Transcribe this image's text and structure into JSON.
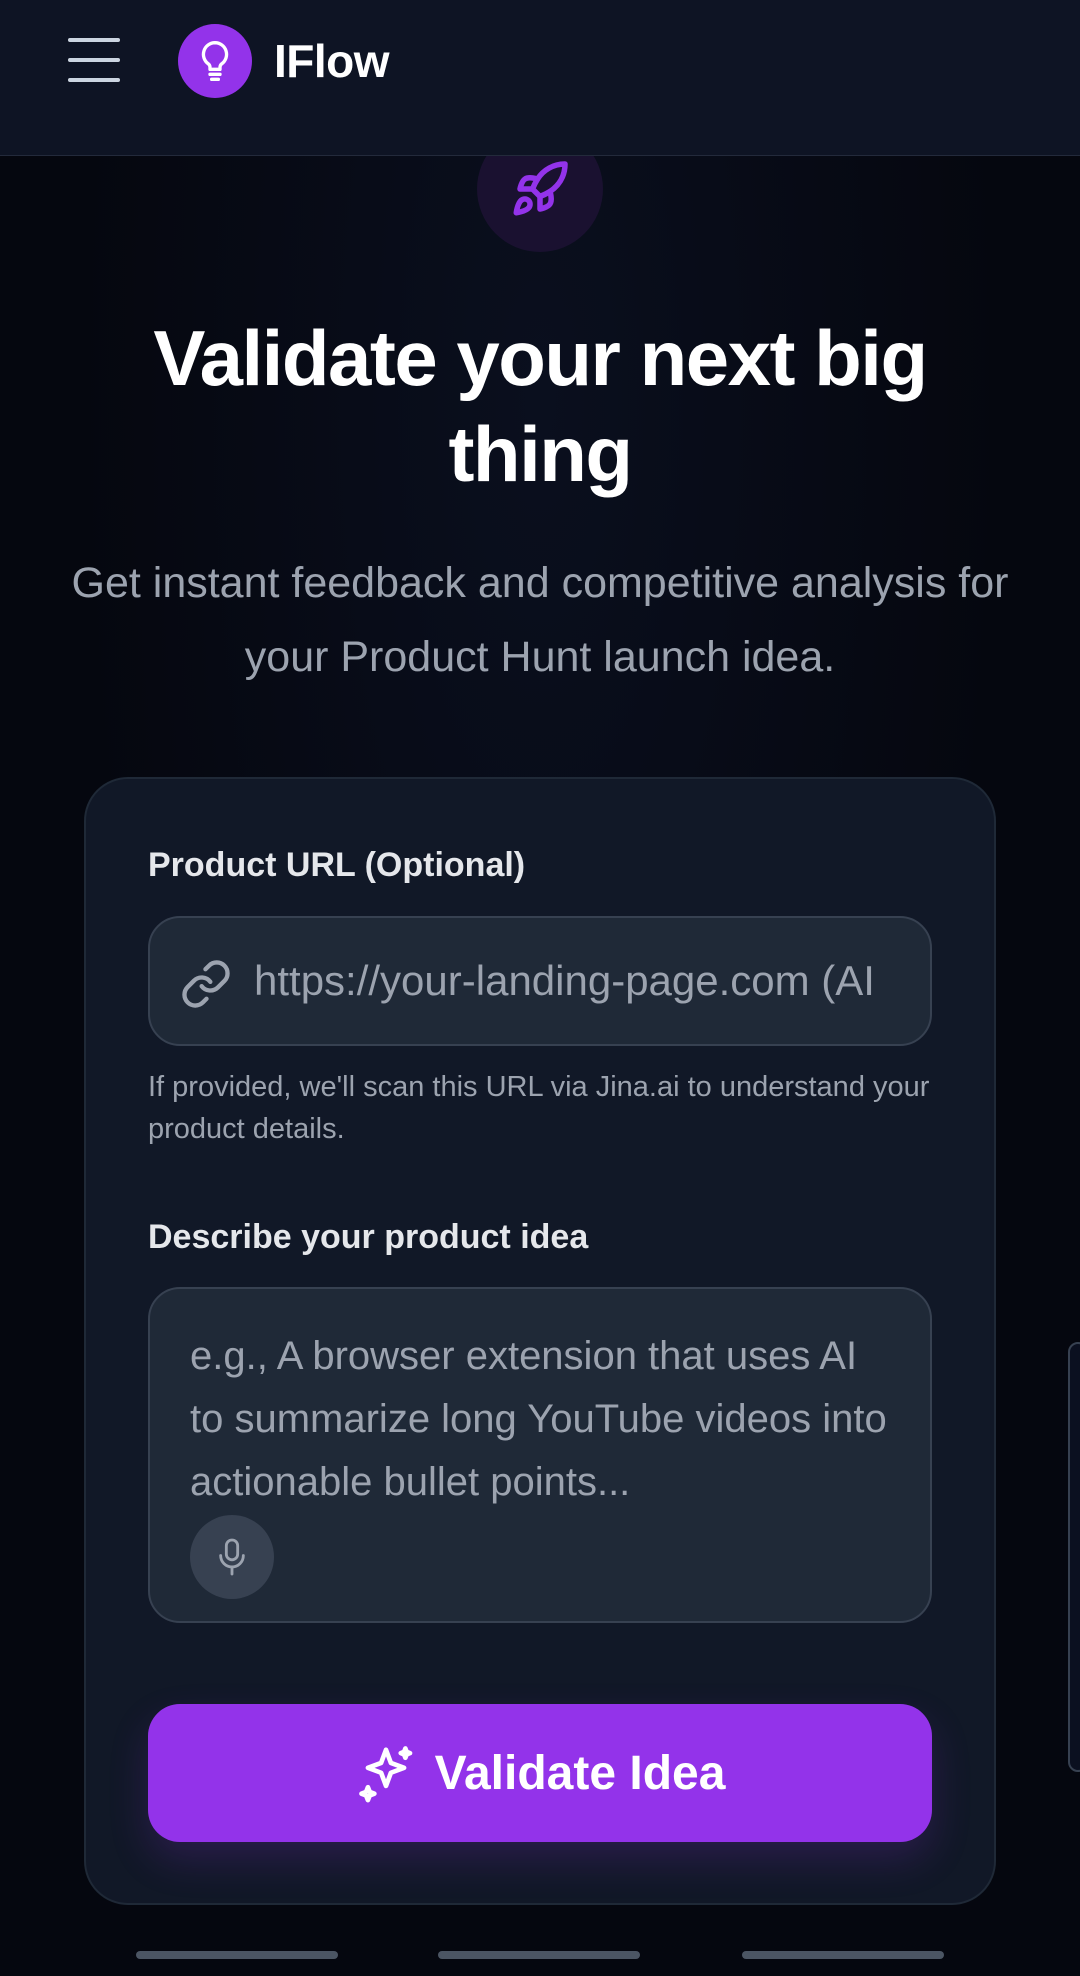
{
  "header": {
    "brand": "IFlow",
    "menu_icon": "hamburger-menu-icon",
    "logo_icon": "lightbulb-icon"
  },
  "hero": {
    "icon": "rocket-icon",
    "title": "Validate your next big thing",
    "subtitle": "Get instant feedback and competitive analysis for your Product Hunt launch idea."
  },
  "form": {
    "url_label": "Product URL (Optional)",
    "url_placeholder": "https://your-landing-page.com (AI",
    "url_value": "",
    "url_icon": "link-icon",
    "url_helper": "If provided, we'll scan this URL via Jina.ai to understand your product details.",
    "idea_label": "Describe your product idea",
    "idea_placeholder": "e.g., A browser extension that uses AI to summarize long YouTube videos into actionable bullet points...",
    "idea_value": "",
    "mic_icon": "microphone-icon",
    "submit_label": "Validate Idea",
    "submit_icon": "sparkles-icon"
  },
  "colors": {
    "accent": "#9333ea",
    "background": "#05070f",
    "card": "#111827",
    "input": "#1f2937"
  }
}
